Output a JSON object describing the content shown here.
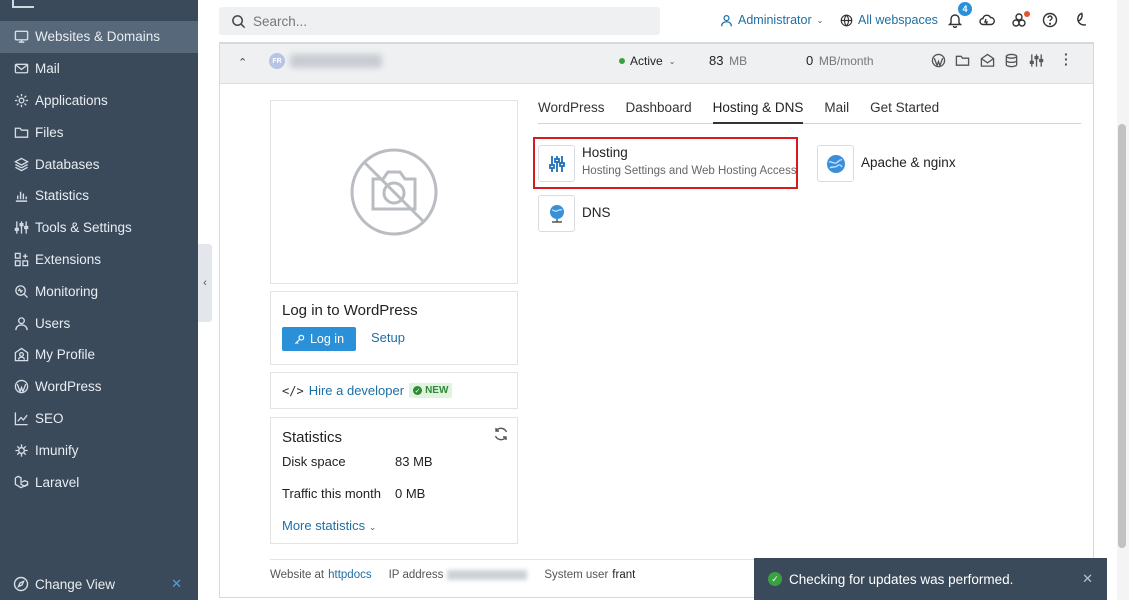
{
  "sidebar": {
    "items": [
      {
        "label": "Websites & Domains",
        "icon": "monitor-icon"
      },
      {
        "label": "Mail",
        "icon": "mail-icon"
      },
      {
        "label": "Applications",
        "icon": "gear-icon"
      },
      {
        "label": "Files",
        "icon": "folder-icon"
      },
      {
        "label": "Databases",
        "icon": "database-icon"
      },
      {
        "label": "Statistics",
        "icon": "bar-chart-icon"
      },
      {
        "label": "Tools & Settings",
        "icon": "sliders-icon"
      },
      {
        "label": "Extensions",
        "icon": "puzzle-icon"
      },
      {
        "label": "Monitoring",
        "icon": "monitoring-icon"
      },
      {
        "label": "Users",
        "icon": "user-icon"
      },
      {
        "label": "My Profile",
        "icon": "profile-icon"
      },
      {
        "label": "WordPress",
        "icon": "wordpress-icon"
      },
      {
        "label": "SEO",
        "icon": "seo-icon"
      },
      {
        "label": "Imunify",
        "icon": "imunify-icon"
      },
      {
        "label": "Laravel",
        "icon": "laravel-icon"
      }
    ],
    "change_view": "Change View"
  },
  "topbar": {
    "search_placeholder": "Search...",
    "user": "Administrator",
    "webspaces": "All webspaces",
    "notification_count": "4"
  },
  "domain": {
    "favicon": "FR",
    "status": "Active",
    "disk_value": "83",
    "disk_unit": "MB",
    "traffic_value": "0",
    "traffic_unit": "MB/month"
  },
  "wordpress_card": {
    "title": "Log in to WordPress",
    "login_label": "Log in",
    "setup_label": "Setup"
  },
  "hire": {
    "code_glyph": "</>",
    "label": "Hire a developer",
    "badge": "NEW"
  },
  "stats": {
    "title": "Statistics",
    "disk_label": "Disk space",
    "disk_value": "83 MB",
    "traffic_label": "Traffic this month",
    "traffic_value": "0 MB",
    "more": "More statistics"
  },
  "tabs": [
    "WordPress",
    "Dashboard",
    "Hosting & DNS",
    "Mail",
    "Get Started"
  ],
  "tools": {
    "hosting_name": "Hosting",
    "hosting_desc": "Hosting Settings and Web Hosting Access",
    "apache_name": "Apache & nginx",
    "dns_name": "DNS"
  },
  "footer": {
    "website_at": "Website at",
    "docroot": "httpdocs",
    "ip_label": "IP address",
    "sysuser_label": "System user",
    "sysuser": "frant"
  },
  "toast": {
    "message": "Checking for updates was performed."
  },
  "colors": {
    "sidebar_bg": "#3b4a5a",
    "accent": "#2a91d8",
    "link": "#1d6fa5",
    "highlight": "#d8191f",
    "success": "#3aa142"
  }
}
